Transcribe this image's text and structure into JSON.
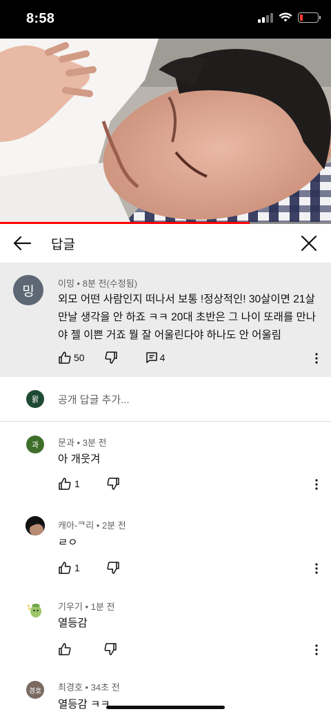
{
  "status_bar": {
    "time": "8:58",
    "battery_level": 0.15
  },
  "video": {
    "progress_fraction": 0.755,
    "progress_color": "#ff0000"
  },
  "header": {
    "title": "답글"
  },
  "parent_comment": {
    "avatar_text": "밍",
    "author": "이밍",
    "time": "8분 전(수정됨)",
    "text": "외모 어떤 사람인지 떠나서 보통 !정상적인! 30살이면 21살 만날 생각을 안 하죠 ㅋㅋ 20대 초반은 그 나이 또래를 만나야 젤 이쁜 거죠 뭘 잘 어울린다야 하나도 안 어울림",
    "likes": "50",
    "reply_count": "4"
  },
  "add_reply": {
    "avatar_text": "왉",
    "placeholder": "공개 답글 추가..."
  },
  "replies": [
    {
      "avatar_text": "과",
      "avatar_color": "#3f6e2a",
      "author": "문과",
      "time": "3분 전",
      "text": "아 개웃겨",
      "likes": "1"
    },
    {
      "avatar_text": "",
      "avatar_color": "#2b2b2b",
      "author": "캐아-ᄏ리",
      "time": "2분 전",
      "text": "ㄹㅇ",
      "likes": "1"
    },
    {
      "avatar_text": "",
      "avatar_color": "#ffffff",
      "author": "기우기",
      "time": "1분 전",
      "text": "열등감",
      "likes": ""
    },
    {
      "avatar_text": "경호",
      "avatar_color": "#7a6a62",
      "author": "최경호",
      "time": "34초 전",
      "text": "열등감 ㅋㅋ",
      "likes": ""
    }
  ],
  "icons": {
    "back": "arrow-left-icon",
    "close": "close-icon",
    "like": "thumbs-up-icon",
    "dislike": "thumbs-down-icon",
    "replies": "comment-icon",
    "more": "more-vertical-icon"
  }
}
